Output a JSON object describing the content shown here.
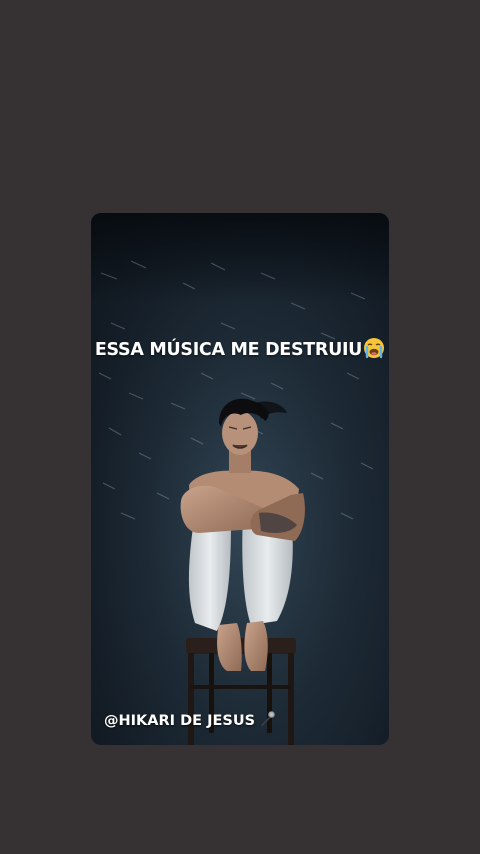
{
  "story": {
    "caption": "ESSA MÚSICA ME DESTRUIU",
    "caption_emoji": "loudly-crying-face-icon",
    "credit": "@HIKARI DE JESUS",
    "credit_emoji": "microphone-icon"
  },
  "colors": {
    "page_background": "#363233",
    "photo_background": "#1e2c38",
    "text": "#ffffff"
  }
}
